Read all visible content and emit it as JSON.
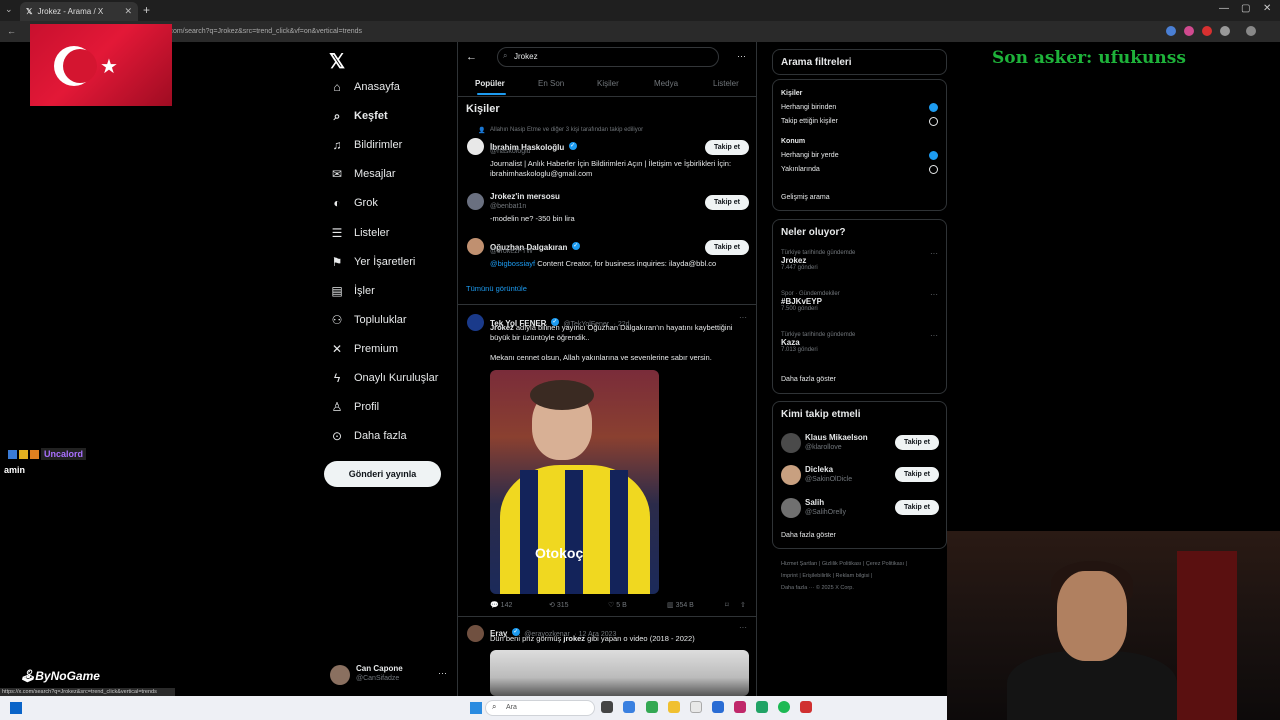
{
  "browser": {
    "tab_title": "Jrokez - Arama / X",
    "address": "x.com/search?q=Jrokez&src=trend_click&vf=on&vertical=trends",
    "status_url": "https://x.com/search?q=Jrokez&src=trend_click&vertical=trends"
  },
  "nav": {
    "items": [
      {
        "label": "Anasayfa",
        "icon": "home-icon"
      },
      {
        "label": "Keşfet",
        "icon": "search-icon"
      },
      {
        "label": "Bildirimler",
        "icon": "bell-icon"
      },
      {
        "label": "Mesajlar",
        "icon": "mail-icon"
      },
      {
        "label": "Grok",
        "icon": "grok-icon"
      },
      {
        "label": "Listeler",
        "icon": "list-icon"
      },
      {
        "label": "Yer İşaretleri",
        "icon": "bookmark-icon"
      },
      {
        "label": "İşler",
        "icon": "briefcase-icon"
      },
      {
        "label": "Topluluklar",
        "icon": "people-icon"
      },
      {
        "label": "Premium",
        "icon": "x-icon"
      },
      {
        "label": "Onaylı Kuruluşlar",
        "icon": "bolt-icon"
      },
      {
        "label": "Profil",
        "icon": "person-icon"
      },
      {
        "label": "Daha fazla",
        "icon": "more-circle-icon"
      }
    ],
    "post_button": "Gönderi yayınla",
    "user": {
      "name": "Can Capone",
      "handle": "@CanSifadze"
    }
  },
  "search": {
    "query": "Jrokez",
    "tabs": [
      "Popüler",
      "En Son",
      "Kişiler",
      "Medya",
      "Listeler"
    ]
  },
  "people": {
    "title": "Kişiler",
    "followed_by": "Allahın Nasip Etme ve diğer 3 kişi tarafından takip ediliyor",
    "list": [
      {
        "name": "İbrahim Haskoloğlu",
        "handle": "@haskologlu",
        "bio": "Journalist | Anlık Haberler İçin Bildirimleri Açın | İletişim ve İşbirlikleri İçin: ibrahimhaskologlu@gmail.com",
        "follow": "Takip et"
      },
      {
        "name": "Jrokez'in mersosu",
        "handle": "@benbat1n",
        "bio": "-modelin ne? -350 bin lira",
        "follow": "Takip et"
      },
      {
        "name": "Oğuzhan Dalgakıran",
        "handle": "@JrokezFTW",
        "bio_link": "@bigbossiayf",
        "bio": " Content Creator, for business inquiries: ilayda@bbl.co",
        "follow": "Takip et"
      }
    ],
    "show_all": "Tümünü görüntüle"
  },
  "tweets": [
    {
      "name": "Tek Yol FENER",
      "handle": "@TekYolFener",
      "time": "· 22d",
      "bold": "Jrokez",
      "text1": " adıyla bilinen yayıncı Oğuzhan Dalgakıran'ın hayatını kaybettiğini büyük bir üzüntüyle öğrendik..",
      "text2": "Mekanı cennet olsun, Allah yakınlarına ve sevenlerine sabır versin.",
      "replies": "142",
      "retweets": "315",
      "likes": "5 B",
      "views": "354 B"
    },
    {
      "name": "Eray",
      "handle": "@erayozkenar",
      "time": "· 12 Ara 2023",
      "text_pre": "Dün beni priz görmüş ",
      "bold": "jrokez",
      "text_post": " gibi yapan o video (2018 - 2022)"
    }
  ],
  "filters": {
    "title": "Arama filtreleri",
    "people_label": "Kişiler",
    "people_options": [
      "Herhangi birinden",
      "Takip ettiğin kişiler"
    ],
    "location_label": "Konum",
    "location_options": [
      "Herhangi bir yerde",
      "Yakınlarında"
    ],
    "advanced": "Gelişmiş arama"
  },
  "trends": {
    "title": "Neler oluyor?",
    "items": [
      {
        "context": "Türkiye tarihinde gündemde",
        "name": "Jrokez",
        "count": "7.447 gönderi"
      },
      {
        "context": "Spor · Gündemdekiler",
        "name": "#BJKvEYP",
        "count": "7.500 gönderi"
      },
      {
        "context": "Türkiye tarihinde gündemde",
        "name": "Kaza",
        "count": "7.013 gönderi"
      }
    ],
    "more": "Daha fazla göster"
  },
  "who_to_follow": {
    "title": "Kimi takip etmeli",
    "items": [
      {
        "name": "Klaus Mikaelson",
        "handle": "@klarollove",
        "follow": "Takip et"
      },
      {
        "name": "Dicleka",
        "handle": "@SakinOlDicle",
        "follow": "Takip et"
      },
      {
        "name": "Salih",
        "handle": "@SalihOrelly",
        "follow": "Takip et"
      }
    ],
    "more": "Daha fazla göster"
  },
  "footer": [
    "Hizmet Şartları",
    "Gizlilik Politikası",
    "Çerez Politikası",
    "Imprint",
    "Erişilebilirlik",
    "Reklam bilgisi",
    "Daha fazla ···",
    "© 2025 X Corp."
  ],
  "overlay": {
    "top_donor": "Son asker: ufukunss",
    "chat_user": "Uncalord",
    "chat_msg": "amin",
    "brand": "ByNoGame"
  },
  "taskbar": {
    "search_placeholder": "Ara"
  },
  "colors": {
    "accent": "#1d9bf0",
    "background": "#000000",
    "text": "#e7e9ea",
    "muted": "#71767b"
  }
}
